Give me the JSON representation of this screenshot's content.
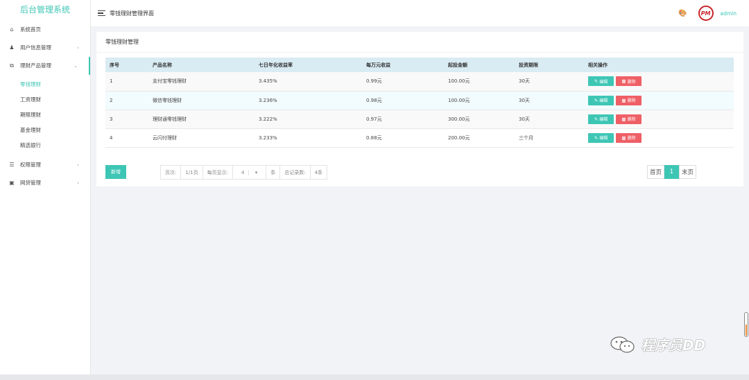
{
  "app": {
    "title": "后台管理系统"
  },
  "sidebar": {
    "items": [
      {
        "label": "系统首页",
        "icon": "home-icon"
      },
      {
        "label": "用户信息管理",
        "icon": "users-icon"
      },
      {
        "label": "理财产品管理",
        "icon": "copy-icon"
      },
      {
        "label": "权限管理",
        "icon": "sliders-icon"
      },
      {
        "label": "网贷管理",
        "icon": "message-icon"
      }
    ],
    "submenu": [
      "零钱理财",
      "工资理财",
      "期限理财",
      "基金理财",
      "精选银行"
    ]
  },
  "header": {
    "title": "零钱理财管理界面",
    "username": "admin",
    "avatar_text": "PM"
  },
  "panel": {
    "title": "零钱理财管理"
  },
  "table": {
    "columns": [
      "序号",
      "产品名称",
      "七日年化收益率",
      "每万元收益",
      "起投金额",
      "投资期限",
      "相关操作"
    ],
    "rows": [
      [
        "1",
        "支付宝零钱理财",
        "3.435%",
        "0.99元",
        "100.00元",
        "30天"
      ],
      [
        "2",
        "微信零钱理财",
        "3.236%",
        "0.98元",
        "100.00元",
        "30天"
      ],
      [
        "3",
        "理财通零钱理财",
        "3.222%",
        "0.97元",
        "300.00元",
        "30天"
      ],
      [
        "4",
        "云闪付理财",
        "3.233%",
        "0.88元",
        "200.00元",
        "三个月"
      ]
    ],
    "edit_label": "编辑",
    "delete_label": "删除"
  },
  "footer": {
    "add_label": "新增",
    "page_label": "页次:",
    "page_value": "1/1页",
    "per_page_label": "每页显示:",
    "per_page_value": "4",
    "per_page_unit": "条",
    "total_label": "总记录数:",
    "total_value": "4条"
  },
  "pager": {
    "first": "首页",
    "current": "1",
    "last": "末页"
  },
  "watermark": {
    "text": "程序员DD"
  },
  "colors": {
    "accent": "#3ec6b5",
    "danger": "#ef5f66",
    "header_row": "#d9ebf3"
  }
}
